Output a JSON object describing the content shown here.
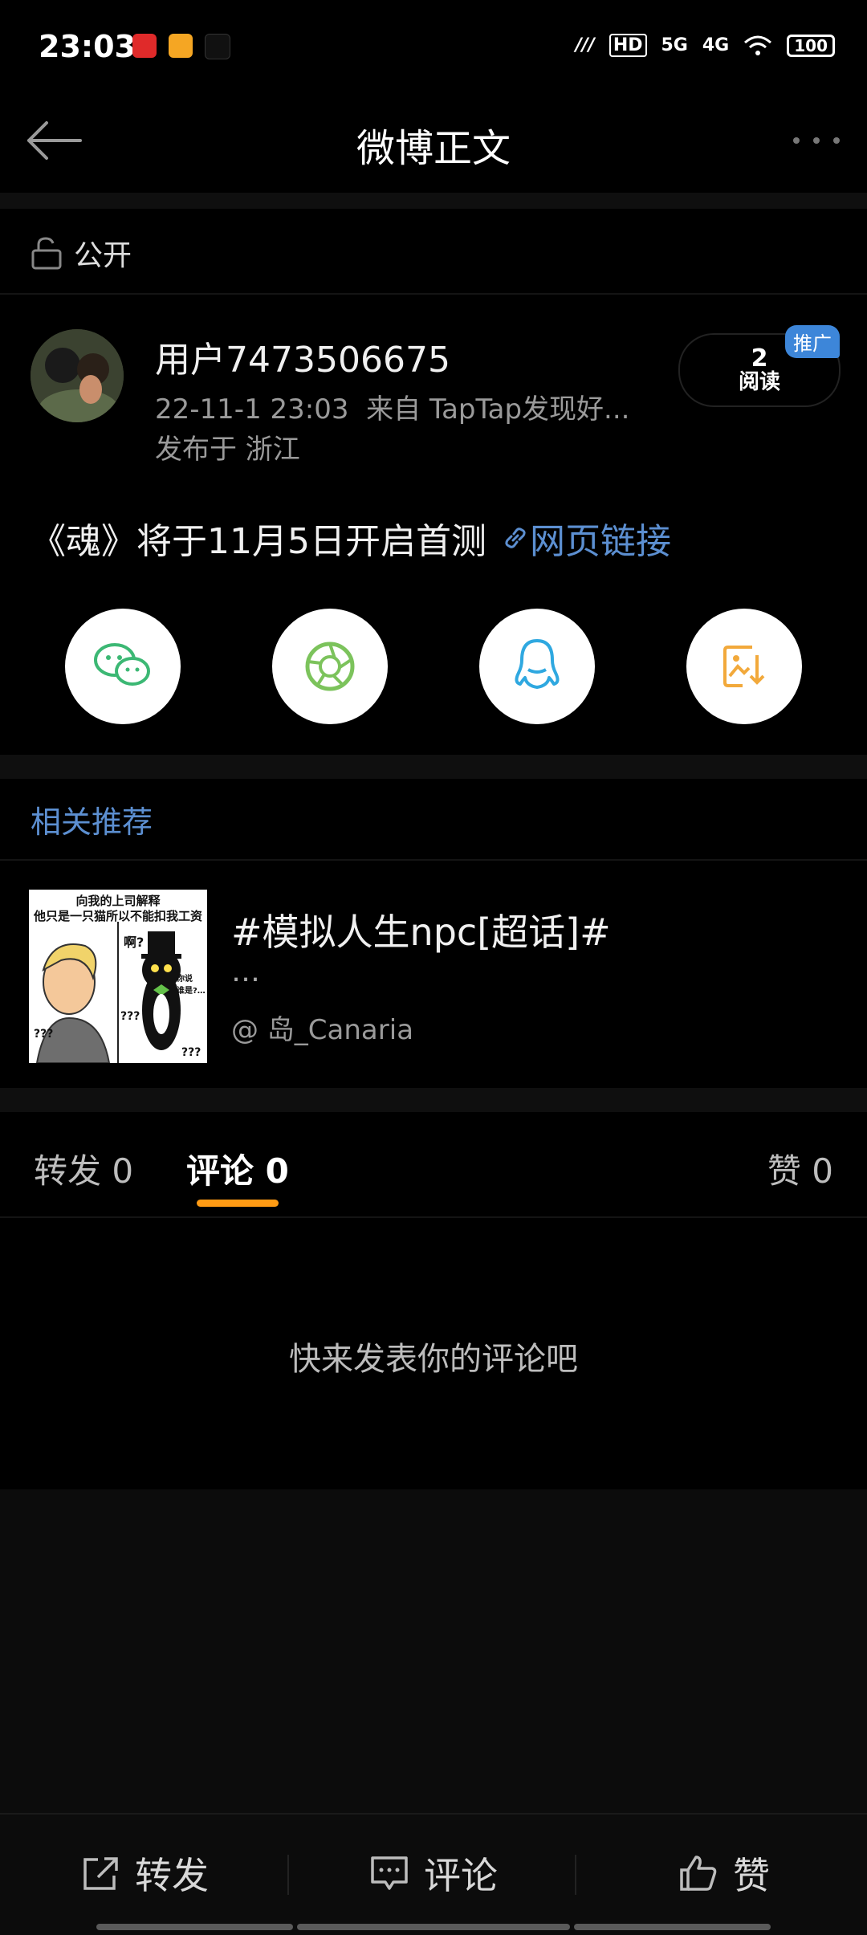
{
  "status_bar": {
    "time": "23:03",
    "network_5g": "5G",
    "network_4g": "4G",
    "hd": "HD",
    "battery": "100"
  },
  "header": {
    "title": "微博正文"
  },
  "visibility": {
    "label": "公开"
  },
  "post": {
    "username": "用户7473506675",
    "date": "22-11-1 23:03",
    "source": "来自 TapTap发现好...",
    "location": "发布于 浙江",
    "reads_count": "2",
    "reads_label": "阅读",
    "promo_badge": "推广",
    "text": "《魂》将于11月5日开启首测",
    "link_label": "网页链接"
  },
  "share_icons": [
    "wechat-icon",
    "moments-icon",
    "qq-icon",
    "save-image-icon"
  ],
  "related": {
    "title": "相关推荐",
    "item_title": "#模拟人生npc[超话]#",
    "item_more": "…",
    "item_user": "@ 岛_Canaria",
    "thumb_caption_line1": "向我的上司解释",
    "thumb_caption_line2": "他只是一只猫所以不能扣我工资",
    "thumb_text_a": "啊?",
    "thumb_text_b": "???",
    "thumb_text_c": "???",
    "thumb_text_d": "???",
    "thumb_text_e": "你说\n谁是?…"
  },
  "tabs": {
    "repost": "转发 0",
    "comment": "评论 0",
    "like": "赞 0"
  },
  "comments": {
    "empty_text": "快来发表你的评论吧"
  },
  "bottom_bar": {
    "repost": "转发",
    "comment": "评论",
    "like": "赞"
  },
  "colors": {
    "accent": "#5c8fd1",
    "tab_indicator": "#ff9b14",
    "promo": "#3d86d9"
  }
}
